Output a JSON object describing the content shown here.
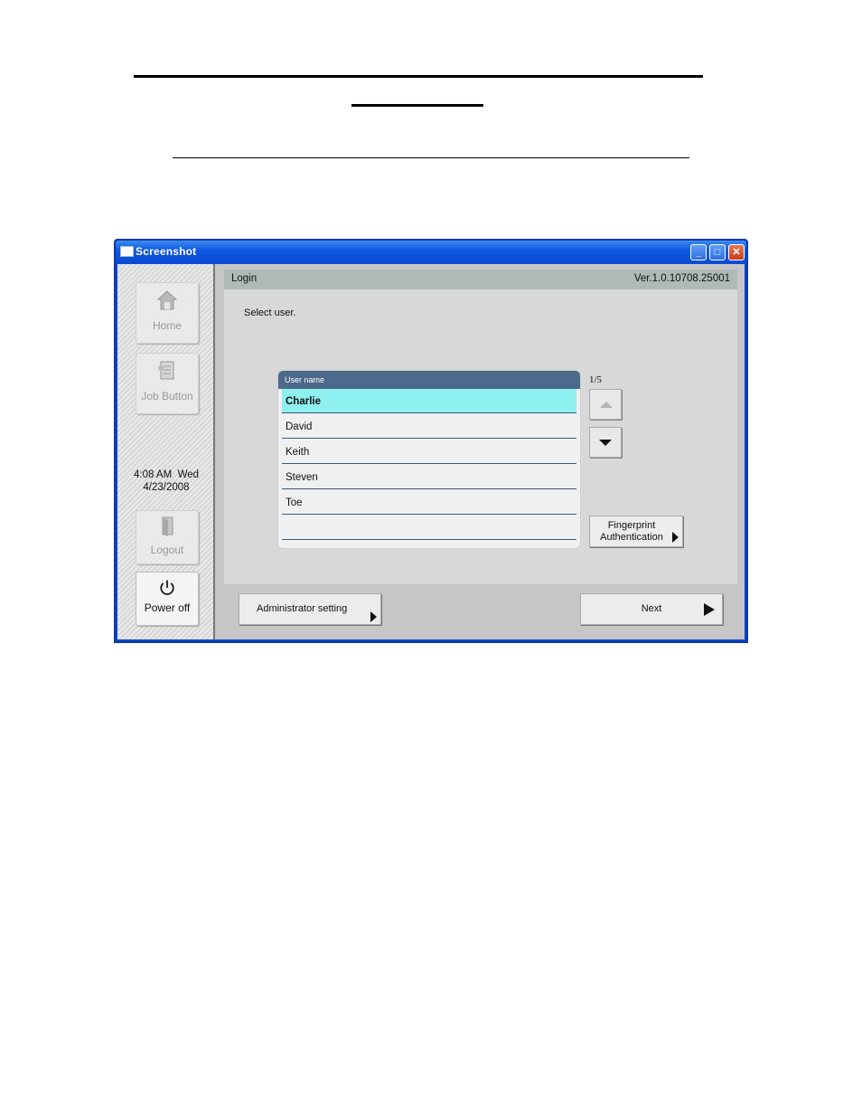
{
  "window": {
    "title": "Screenshot",
    "minimize_glyph": "_",
    "maximize_glyph": "□",
    "close_glyph": "✕"
  },
  "sidebar": {
    "home_label": "Home",
    "job_button_label": "Job Button",
    "clock_time": "4:08 AM  Wed",
    "clock_date": "4/23/2008",
    "logout_label": "Logout",
    "power_off_label": "Power off"
  },
  "header": {
    "title": "Login",
    "version": "Ver.1.0.10708.25001"
  },
  "main": {
    "prompt": "Select user.",
    "list_header": "User name",
    "users": [
      "Charlie",
      "David",
      "Keith",
      "Steven",
      "Toe",
      ""
    ],
    "selected_index": 0,
    "page_indicator": "1/5",
    "fingerprint_line1": "Fingerprint",
    "fingerprint_line2": "Authentication"
  },
  "footer": {
    "admin_label": "Administrator setting",
    "next_label": "Next"
  },
  "colors": {
    "selected_row": "#8ef0ef",
    "list_header": "#4c6a8a",
    "titlebar": "#0b4ad2"
  }
}
